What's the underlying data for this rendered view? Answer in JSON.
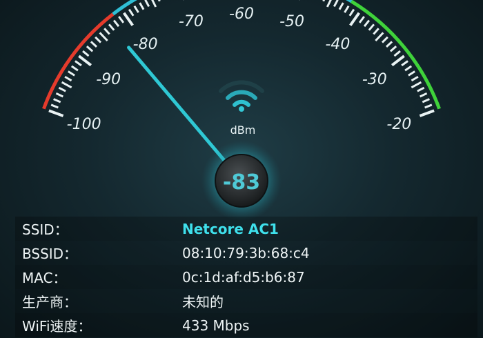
{
  "gauge": {
    "min": -100,
    "max": -20,
    "labels": [
      "-100",
      "-90",
      "-80",
      "-70",
      "-60",
      "-50",
      "-40",
      "-30",
      "-20"
    ],
    "label_values": [
      -100,
      -90,
      -80,
      -70,
      -60,
      -50,
      -40,
      -30,
      -20
    ],
    "unit": "dBm",
    "current_value": -83,
    "current_display": "-83",
    "needle_icon": "wifi-icon",
    "colors": {
      "low": "#e53b2c",
      "mid": "#2fbfd6",
      "high": "#3fd23a",
      "needle": "#2fc8d4"
    }
  },
  "info": {
    "ssid_label": "SSID：",
    "ssid_value": "Netcore AC1",
    "bssid_label": "BSSID：",
    "bssid_value": "08:10:79:3b:68:c4",
    "mac_label": "MAC：",
    "mac_value": "0c:1d:af:d5:b6:87",
    "vendor_label": "生产商：",
    "vendor_value": "未知的",
    "speed_label": "WiFi速度：",
    "speed_value": "433 Mbps"
  }
}
